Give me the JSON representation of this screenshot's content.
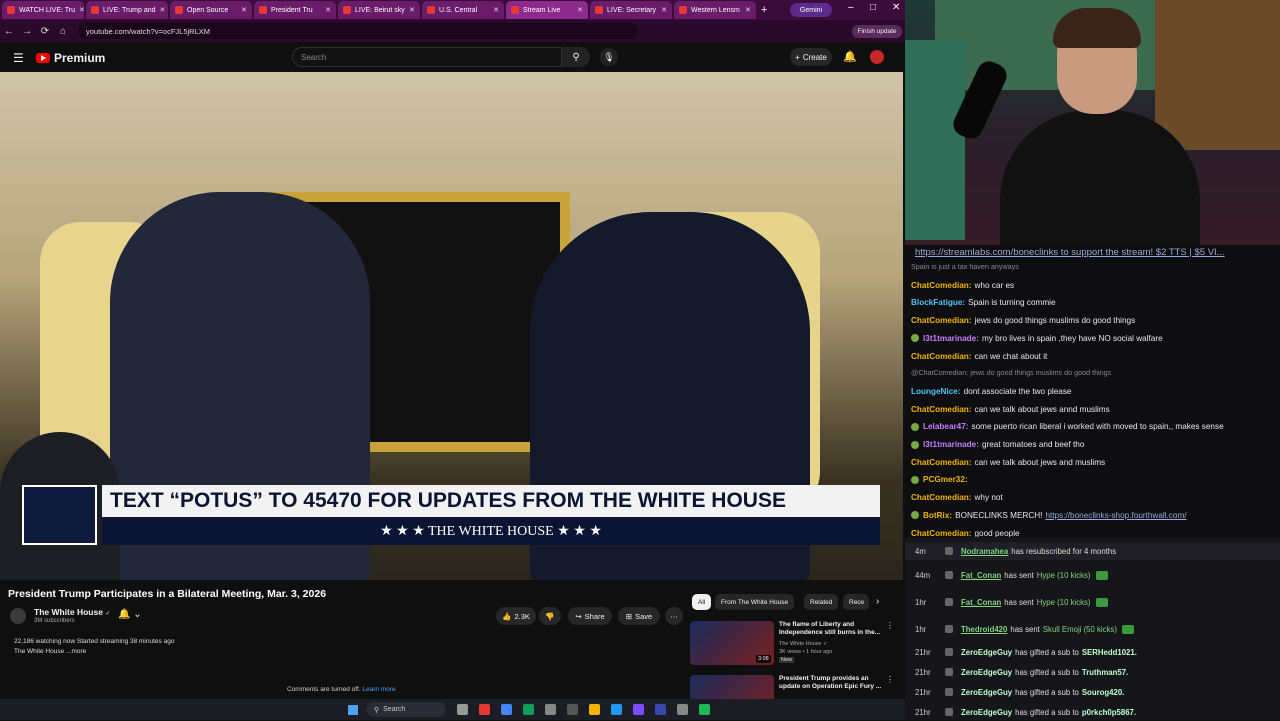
{
  "browser": {
    "tabs": [
      {
        "label": "WATCH LIVE: Tru"
      },
      {
        "label": "LIVE: Trump and"
      },
      {
        "label": "Open Source"
      },
      {
        "label": "President Tru"
      },
      {
        "label": "LIVE: Beirut sky"
      },
      {
        "label": "U.S. Central"
      },
      {
        "label": "Stream Live"
      },
      {
        "label": "LIVE: Secretary"
      },
      {
        "label": "Western Lensm"
      }
    ],
    "new_tab": "+",
    "gemini_label": "Gemini",
    "url": "youtube.com/watch?v=ocFJL5jRLXM",
    "finish_update": "Finish update"
  },
  "youtube": {
    "brand": "Premium",
    "search_placeholder": "Search",
    "create_label": "Create",
    "video": {
      "overlay_main": "TEXT “POTUS” TO 45470 FOR UPDATES FROM THE WHITE HOUSE",
      "overlay_sub": "★ ★ ★  THE WHITE HOUSE  ★ ★ ★"
    },
    "title": "President Trump Participates in a Bilateral Meeting, Mar. 3, 2026",
    "channel": {
      "name": "The White House",
      "verified": "✓",
      "subs": "3M subscribers"
    },
    "actions": {
      "likes": "2.3K",
      "share": "Share",
      "save": "Save",
      "more": "⋯"
    },
    "description": {
      "line1": "22,186 watching now  Started streaming 38 minutes ago",
      "line2": "The White House ...more"
    },
    "comments_off": "Comments are turned off.",
    "learn_more": "Learn more",
    "chips": [
      "All",
      "From The White House",
      "Related",
      "Rece"
    ],
    "recs": [
      {
        "title": "The flame of Liberty and Independence still burns in the...",
        "channel": "The White House ✓",
        "meta": "3K views • 1 hour ago",
        "badge": "New",
        "duration": "3:08"
      },
      {
        "title": "President Trump provides an update on Operation Epic Fury ...",
        "channel": "",
        "meta": "",
        "badge": "",
        "duration": ""
      }
    ]
  },
  "taskbar": {
    "search": "Search"
  },
  "stream": {
    "promo_link": "https://streamlabs.com/boneclinks",
    "promo_rest": " to support the stream! $2 TTS | $5 VI...",
    "chat": [
      {
        "kind": "reply",
        "text": "Spain is just a tax haven anyways"
      },
      {
        "user": "ChatComedian:",
        "color": "#f0b400",
        "text": "who car es"
      },
      {
        "user": "BlockFatigue:",
        "color": "#4fc3f7",
        "text": "Spain is turning commie"
      },
      {
        "user": "ChatComedian:",
        "color": "#f0b400",
        "text": "jews do good things muslims do good things"
      },
      {
        "user": "l3t1tmarinade:",
        "color": "#c77dff",
        "text": "my bro lives in spain ,they have NO social walfare",
        "badge": true
      },
      {
        "user": "ChatComedian:",
        "color": "#f0b400",
        "text": "can we chat about it"
      },
      {
        "kind": "reply",
        "text": "@ChatComedian: jews do good things muslims do good things"
      },
      {
        "user": "LoungeNice:",
        "color": "#4fc3f7",
        "text": "dont associate the two please"
      },
      {
        "user": "ChatComedian:",
        "color": "#f0b400",
        "text": "can we talk about jews annd muslims"
      },
      {
        "user": "Lelabear47:",
        "color": "#c77dff",
        "text": "some puerto rican liberal i worked with moved to spain,, makes sense",
        "badge": true
      },
      {
        "user": "l3t1tmarinade:",
        "color": "#c77dff",
        "text": "great tomatoes and beef tho",
        "badge": true
      },
      {
        "user": "ChatComedian:",
        "color": "#f0b400",
        "text": "can we talk about jews and muslims"
      },
      {
        "user": "PCGmer32:",
        "color": "#f0b400",
        "text": "",
        "badge": true
      },
      {
        "user": "ChatComedian:",
        "color": "#f0b400",
        "text": "why not"
      },
      {
        "user": "BotRix:",
        "color": "#f0b400",
        "text": "BONECLINKS MERCH!",
        "link": "https://boneclinks-shop.fourthwall.com/",
        "badge": true
      },
      {
        "user": "ChatComedian:",
        "color": "#f0b400",
        "text": "good people"
      }
    ],
    "events": [
      {
        "time": "4m",
        "name": "Nodramahea",
        "text": "has resubscribed for 4 months",
        "hype": "",
        "kicks": false,
        "hl": true
      },
      {
        "time": "44m",
        "name": "Fat_Conan",
        "text": "has sent",
        "hype": "Hype (10 kicks)",
        "kicks": true,
        "hl": false
      },
      {
        "time": "1hr",
        "name": "Fat_Conan",
        "text": "has sent",
        "hype": "Hype (10 kicks)",
        "kicks": true,
        "hl": false
      },
      {
        "time": "1hr",
        "name": "Thedroid420",
        "text": "has sent",
        "hype": "Skull Emoji (50 kicks)",
        "kicks": true,
        "hl": false
      },
      {
        "time": "21hr",
        "name": "ZeroEdgeGuy",
        "text": "has gifted a sub to",
        "target": "SERHedd1021.",
        "plain": true
      },
      {
        "time": "21hr",
        "name": "ZeroEdgeGuy",
        "text": "has gifted a sub to",
        "target": "Truthman57.",
        "plain": true
      },
      {
        "time": "21hr",
        "name": "ZeroEdgeGuy",
        "text": "has gifted a sub to",
        "target": "Sourog420.",
        "plain": true
      },
      {
        "time": "21hr",
        "name": "ZeroEdgeGuy",
        "text": "has gifted a sub to",
        "target": "p0rkch0p5867.",
        "plain": true
      }
    ]
  },
  "colors": {
    "accent": "#ff0000",
    "chat_bg": "#0e0e10",
    "tab_bg": "#6a1b6a"
  }
}
